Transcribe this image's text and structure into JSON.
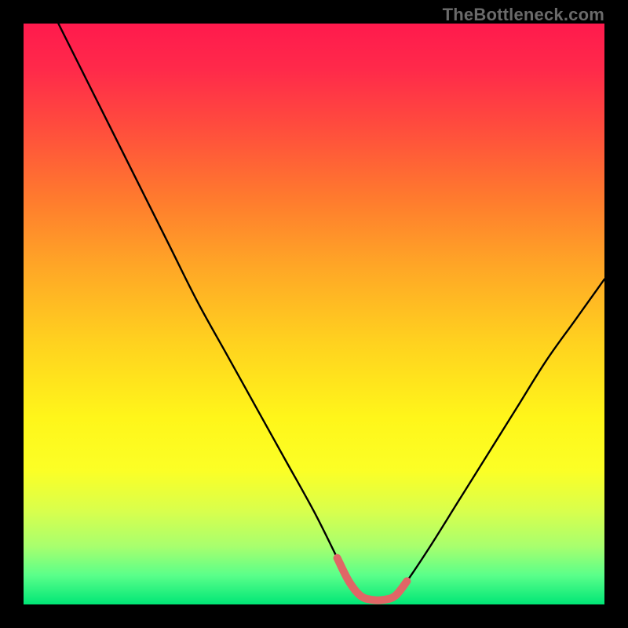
{
  "watermark": "TheBottleneck.com",
  "chart_data": {
    "type": "line",
    "title": "",
    "xlabel": "",
    "ylabel": "",
    "xlim": [
      0,
      100
    ],
    "ylim": [
      0,
      100
    ],
    "series": [
      {
        "name": "bottleneck-curve",
        "x": [
          6,
          10,
          15,
          20,
          25,
          30,
          35,
          40,
          45,
          50,
          54,
          56,
          58,
          60,
          62,
          64,
          66,
          70,
          75,
          80,
          85,
          90,
          95,
          100
        ],
        "y": [
          100,
          92,
          82,
          72,
          62,
          52,
          43,
          34,
          25,
          16,
          8,
          4,
          1.5,
          0.8,
          0.8,
          1.5,
          4,
          10,
          18,
          26,
          34,
          42,
          49,
          56
        ]
      },
      {
        "name": "flat-bottom-highlight",
        "x": [
          54,
          56,
          58,
          60,
          62,
          64,
          66
        ],
        "y": [
          8,
          4,
          1.5,
          0.8,
          0.8,
          1.5,
          4
        ]
      }
    ],
    "colors": {
      "curve": "#000000",
      "highlight": "#e06666",
      "background_top": "#ff1a4d",
      "background_bottom": "#00e676"
    }
  }
}
